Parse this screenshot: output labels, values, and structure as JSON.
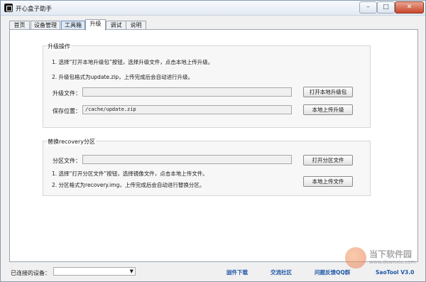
{
  "window": {
    "title": "开心盒子助手",
    "minimize": "–",
    "maximize": "□",
    "close": "✕"
  },
  "tabs": [
    {
      "label": "首页"
    },
    {
      "label": "设备管理"
    },
    {
      "label": "工具箱"
    },
    {
      "label": "升级"
    },
    {
      "label": "调试"
    },
    {
      "label": "说明"
    }
  ],
  "upgrade_group": {
    "title": "升级操作",
    "hint1": "1. 选择“打开本地升级包”按钮，选择升级文件，点击本地上传升级。",
    "hint2": "2. 升级包格式为update.zip，上传完成后会自动进行升级。",
    "file_label": "升级文件：",
    "file_value": "",
    "open_button": "打开本地升级包",
    "save_label": "保存位置：",
    "save_value": "/cache/update.zip",
    "upload_button": "本地上传升级"
  },
  "recovery_group": {
    "title": "替换recovery分区",
    "file_label": "分区文件：",
    "file_value": "",
    "open_button": "打开分区文件",
    "hint1": "1. 选择“打开分区文件”按钮，选择镜像文件，点击本地上传文件。",
    "hint2": "2. 分区格式为recovery.img，上传完成后会自动进行替换分区。",
    "upload_button": "本地上传文件"
  },
  "statusbar": {
    "device_label": "已连接的设备：",
    "device_value": "",
    "links": [
      "固件下载",
      "交流社区",
      "问题反馈QQ群"
    ],
    "version": "SaoTool V3.0"
  },
  "watermark": {
    "text": "当下软件园",
    "url": "www.downxia.com"
  }
}
